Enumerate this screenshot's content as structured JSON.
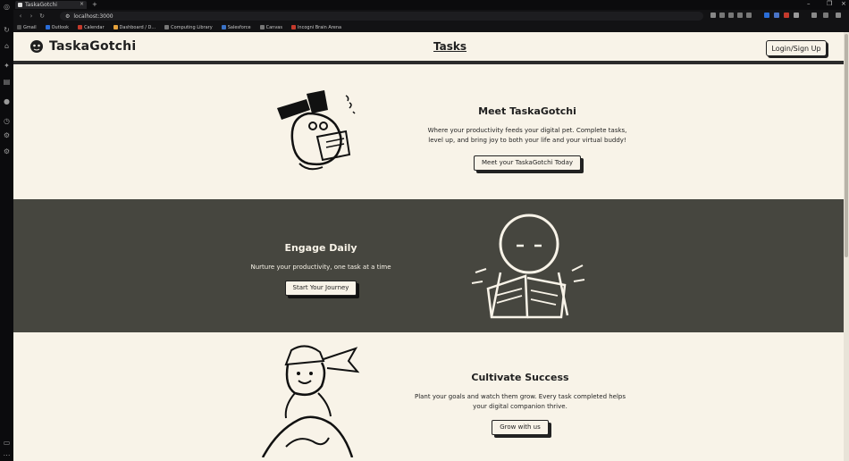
{
  "browser": {
    "tab_title": "TaskaGotchi",
    "url": "localhost:3000",
    "bookmarks": [
      "Gmail",
      "Outlook",
      "Calendar",
      "Dashboard / D...",
      "Computing Library",
      "Salesforce",
      "Canvas",
      "Incogni Brain Arena"
    ]
  },
  "header": {
    "logo_text": "TaskaGotchi",
    "nav_link": "Tasks",
    "login_label": "Login/Sign Up"
  },
  "hero": {
    "title": "Meet TaskaGotchi",
    "text_line1": "Where your productivity feeds your digital pet. Complete tasks,",
    "text_line2": "level up, and bring joy to both your life and your virtual buddy!",
    "button": "Meet your TaskaGotchi Today"
  },
  "daily": {
    "title": "Engage Daily",
    "text": "Nurture your productivity, one task at a time",
    "button": "Start Your Journey"
  },
  "success": {
    "title": "Cultivate Success",
    "text_line1": "Plant your goals and watch them grow. Every task completed helps",
    "text_line2": "your digital companion thrive.",
    "button": "Grow with us"
  },
  "colors": {
    "cream": "#f8f3e8",
    "dark_band": "#46463f",
    "ink": "#1f1f1f"
  }
}
